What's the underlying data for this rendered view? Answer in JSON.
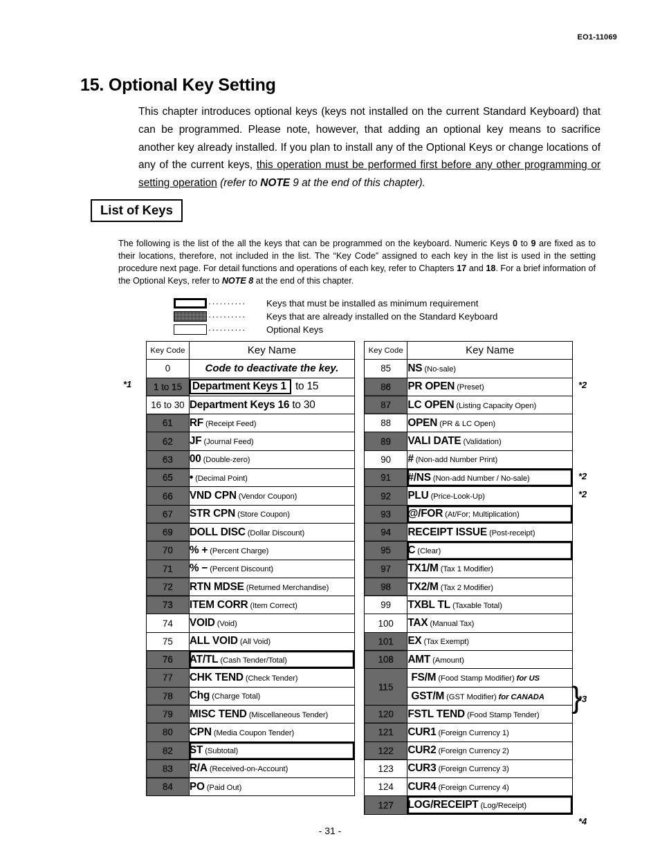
{
  "document": {
    "doc_code": "EO1-11069",
    "page_number": "- 31 -"
  },
  "chapter": {
    "title": "15. Optional Key Setting",
    "intro_part1": "This chapter introduces optional keys (keys not installed on the current Standard Keyboard) that can be programmed.  Please note, however, that adding an optional key means to sacrifice another key already installed.  If you plan to install any of the Optional Keys or change locations of any of the current keys, ",
    "intro_underlined": "this operation must be performed first before any other programming or setting operation",
    "intro_paren_open": " (refer to ",
    "intro_note_bold": "NOTE",
    "intro_paren_rest": " 9 at the end of this chapter)."
  },
  "section": {
    "heading": "List of Keys",
    "description_1": "The following is the list of the all the keys that can be programmed on the keyboard.  Numeric Keys ",
    "description_b1": "0",
    "description_2": " to ",
    "description_b2": "9",
    "description_3": " are fixed as to their locations, therefore, not included in the list.  The “Key Code” assigned to each key in the list is used in the setting procedure next page.  For detail functions and operations of each key, refer to Chapters ",
    "description_b3": "17",
    "description_4": " and ",
    "description_b4": "18",
    "description_5": ".  For a brief information of the Optional Keys, refer to ",
    "description_b5": "NOTE 8",
    "description_6": " at the end of this chapter."
  },
  "legend": {
    "dots": "··········",
    "items": [
      {
        "swatch": "minimum-requirement",
        "label": "Keys that must be installed as minimum requirement"
      },
      {
        "swatch": "standard-installed",
        "label": "Keys that are already installed on the Standard Keyboard"
      },
      {
        "swatch": "optional",
        "label": "Optional Keys"
      }
    ]
  },
  "table_headers": {
    "key_code": "Key Code",
    "key_name": "Key Name"
  },
  "footnotes": {
    "f1": "*1",
    "f2": "*2",
    "f3": "*3",
    "f4": "*4"
  },
  "left_table": {
    "rows": [
      {
        "code": "0",
        "shaded": false,
        "name": "",
        "desc": "",
        "italic_text": "Code to deactivate the key.",
        "boxed_name": false
      },
      {
        "code": "1 to 15",
        "shaded": true,
        "name": "Department Keys 1",
        "desc": "",
        "tail": " to 15",
        "boxed_name": true
      },
      {
        "code": "16 to 30",
        "shaded": false,
        "name": "Department Keys 16",
        "desc": "",
        "tail": " to 30",
        "boxed_name": false
      },
      {
        "code": "61",
        "shaded": true,
        "name": "RF",
        "desc": "(Receipt Feed)"
      },
      {
        "code": "62",
        "shaded": true,
        "name": "JF",
        "desc": "(Journal Feed)"
      },
      {
        "code": "63",
        "shaded": true,
        "name": "00",
        "desc": "(Double-zero)"
      },
      {
        "code": "65",
        "shaded": true,
        "name": "•",
        "desc": "(Decimal Point)"
      },
      {
        "code": "66",
        "shaded": true,
        "name": "VND CPN",
        "desc": "(Vendor Coupon)"
      },
      {
        "code": "67",
        "shaded": true,
        "name": "STR CPN",
        "desc": "(Store Coupon)"
      },
      {
        "code": "69",
        "shaded": true,
        "name": "DOLL DISC",
        "desc": "(Dollar Discount)"
      },
      {
        "code": "70",
        "shaded": true,
        "name": "% +",
        "desc": "(Percent Charge)"
      },
      {
        "code": "71",
        "shaded": true,
        "name": "% −",
        "desc": "(Percent Discount)"
      },
      {
        "code": "72",
        "shaded": true,
        "name": "RTN MDSE",
        "desc": "(Returned Merchandise)"
      },
      {
        "code": "73",
        "shaded": true,
        "name": "ITEM CORR",
        "desc": "(Item Correct)"
      },
      {
        "code": "74",
        "shaded": false,
        "name": "VOID",
        "desc": "(Void)"
      },
      {
        "code": "75",
        "shaded": false,
        "name": "ALL VOID",
        "desc": "(All Void)"
      },
      {
        "code": "76",
        "shaded": true,
        "name": "AT/TL",
        "desc": "(Cash Tender/Total)",
        "row_boxed": true
      },
      {
        "code": "77",
        "shaded": true,
        "name": "CHK TEND",
        "desc": "(Check Tender)"
      },
      {
        "code": "78",
        "shaded": true,
        "name": "Chg",
        "desc": "(Charge Total)"
      },
      {
        "code": "79",
        "shaded": true,
        "name": "MISC TEND",
        "desc": "(Miscellaneous Tender)"
      },
      {
        "code": "80",
        "shaded": true,
        "name": "CPN",
        "desc": "(Media Coupon Tender)"
      },
      {
        "code": "82",
        "shaded": true,
        "name": "ST",
        "desc": "(Subtotal)",
        "row_boxed": true
      },
      {
        "code": "83",
        "shaded": true,
        "name": "R/A",
        "desc": "(Received-on-Account)"
      },
      {
        "code": "84",
        "shaded": true,
        "name": "PO",
        "desc": "(Paid Out)"
      }
    ]
  },
  "right_table": {
    "rows": [
      {
        "code": "85",
        "shaded": false,
        "name": "NS",
        "desc": "(No-sale)",
        "note": "*2"
      },
      {
        "code": "86",
        "shaded": true,
        "name": "PR OPEN",
        "desc": "(Preset)"
      },
      {
        "code": "87",
        "shaded": true,
        "name": "LC OPEN",
        "desc": "(Listing Capacity Open)"
      },
      {
        "code": "88",
        "shaded": false,
        "name": "OPEN",
        "desc": "(PR & LC Open)"
      },
      {
        "code": "89",
        "shaded": true,
        "name": "VALI DATE",
        "desc": "(Validation)"
      },
      {
        "code": "90",
        "shaded": false,
        "name": "#",
        "desc": "(Non-add Number Print)",
        "note": "*2"
      },
      {
        "code": "91",
        "shaded": true,
        "name": "#/NS",
        "desc": "(Non-add Number / No-sale)",
        "note": "*2",
        "row_boxed": true
      },
      {
        "code": "92",
        "shaded": true,
        "name": "PLU",
        "desc": "(Price-Look-Up)"
      },
      {
        "code": "93",
        "shaded": true,
        "name": "@/FOR",
        "desc": "(At/For; Multiplication)",
        "row_boxed": true
      },
      {
        "code": "94",
        "shaded": true,
        "name": "RECEIPT ISSUE",
        "desc": "(Post-receipt)"
      },
      {
        "code": "95",
        "shaded": true,
        "name": "C",
        "desc": "(Clear)",
        "row_boxed": true
      },
      {
        "code": "97",
        "shaded": true,
        "name": "TX1/M",
        "desc": "(Tax 1 Modifier)"
      },
      {
        "code": "98",
        "shaded": true,
        "name": "TX2/M",
        "desc": "(Tax 2 Modifier)"
      },
      {
        "code": "99",
        "shaded": false,
        "name": "TXBL TL",
        "desc": "(Taxable Total)"
      },
      {
        "code": "100",
        "shaded": false,
        "name": "TAX",
        "desc": "(Manual Tax)"
      },
      {
        "code": "101",
        "shaded": true,
        "name": "EX",
        "desc": "(Tax Exempt)"
      },
      {
        "code": "108",
        "shaded": true,
        "name": "AMT",
        "desc": "(Amount)"
      },
      {
        "code": "115",
        "shaded": true,
        "split": true,
        "note": "*3",
        "sub_rows": [
          {
            "name": "FS/M",
            "desc": "(Food Stamp Modifier)",
            "region": "for US"
          },
          {
            "name": "GST/M",
            "desc": "(GST Modifier)",
            "region": "for CANADA"
          }
        ]
      },
      {
        "code": "120",
        "shaded": true,
        "name": "FSTL TEND",
        "desc": "(Food Stamp Tender)"
      },
      {
        "code": "121",
        "shaded": true,
        "name": "CUR1",
        "desc": "(Foreign Currency 1)"
      },
      {
        "code": "122",
        "shaded": true,
        "name": "CUR2",
        "desc": "(Foreign Currency 2)"
      },
      {
        "code": "123",
        "shaded": false,
        "name": "CUR3",
        "desc": "(Foreign Currency 3)"
      },
      {
        "code": "124",
        "shaded": false,
        "name": "CUR4",
        "desc": "(Foreign Currency 4)"
      },
      {
        "code": "127",
        "shaded": true,
        "name": "LOG/RECEIPT",
        "desc": "(Log/Receipt)",
        "note": "*4",
        "row_boxed": true
      }
    ]
  }
}
